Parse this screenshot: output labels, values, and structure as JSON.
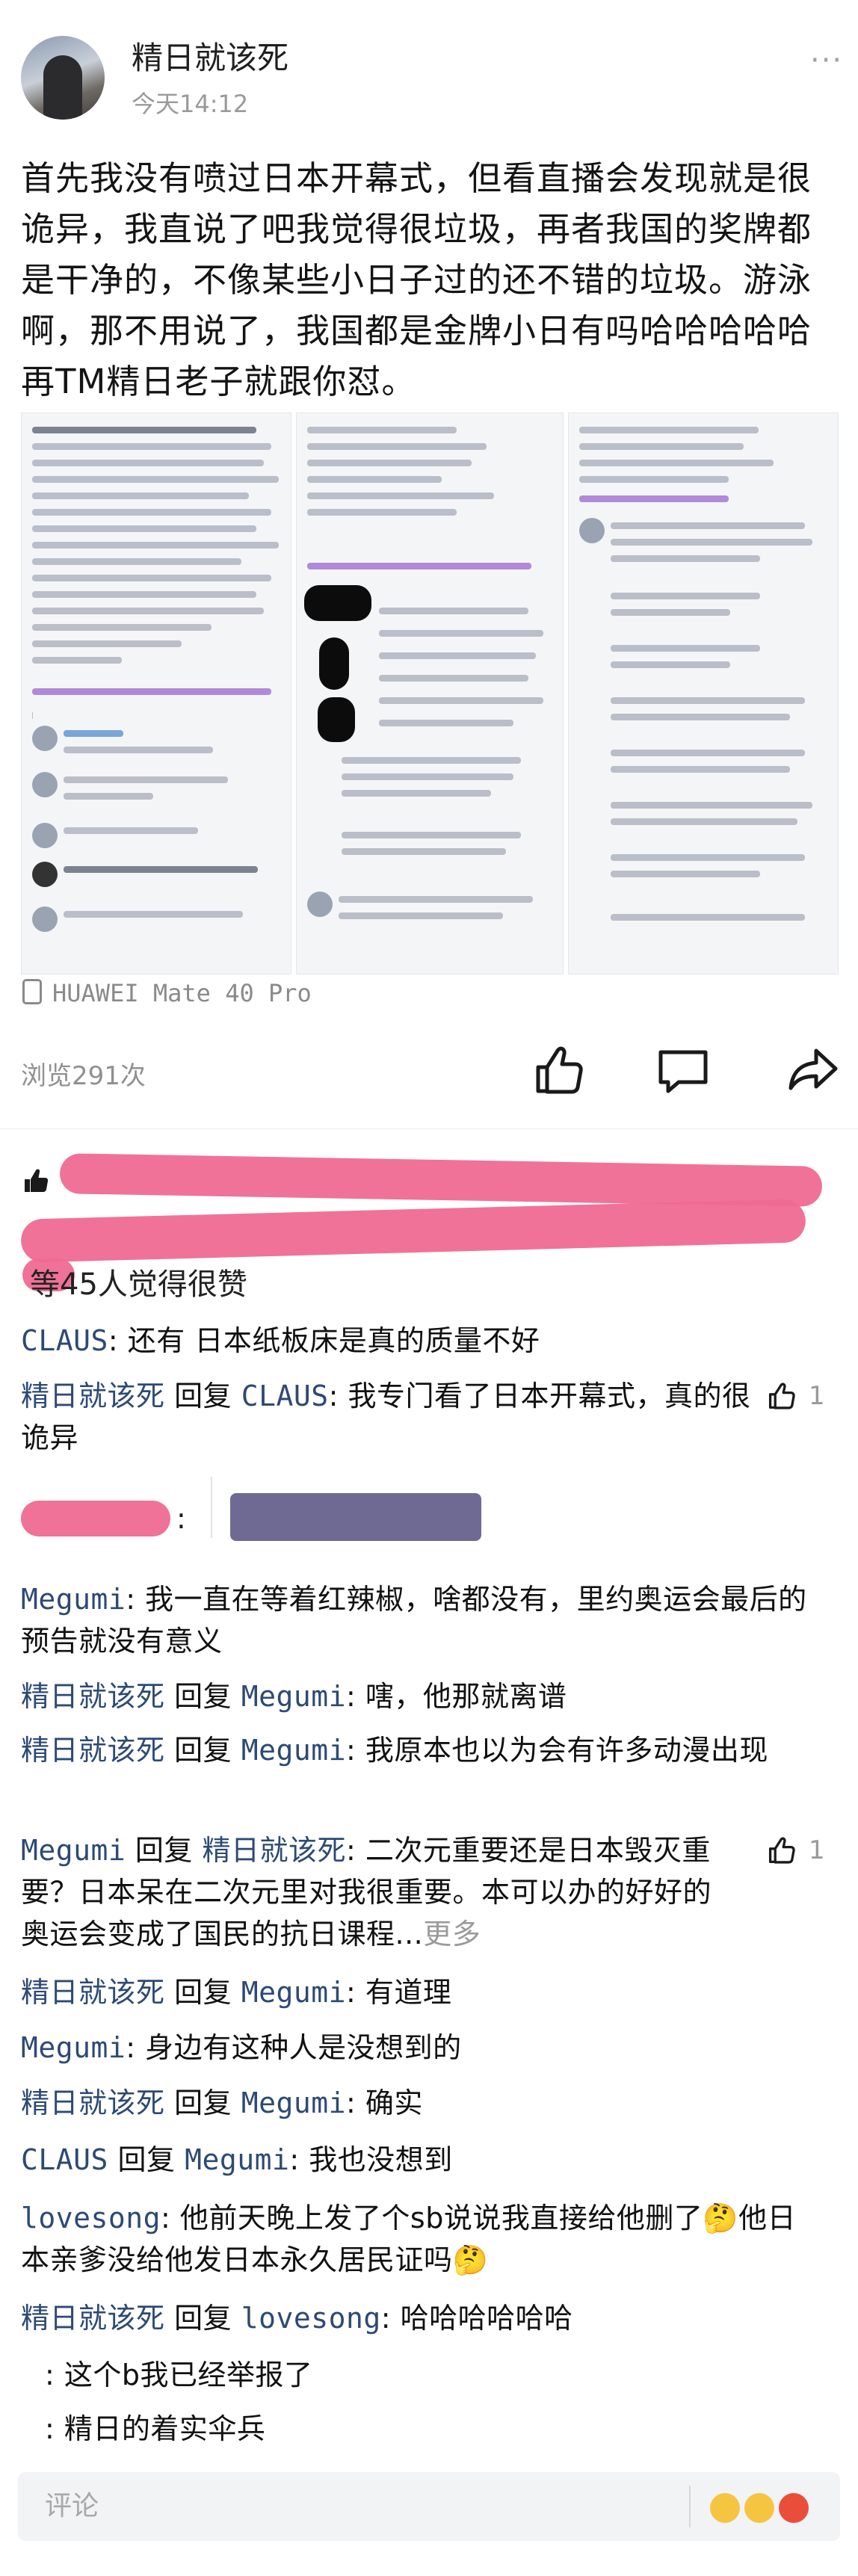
{
  "post": {
    "author": "精日就该死",
    "time": "今天14:12",
    "more": "···",
    "text": "首先我没有喷过日本开幕式，但看直播会发现就是很诡异，我直说了吧我觉得很垃圾，再者我国的奖牌都是干净的，不像某些小日子过的还不错的垃圾。游泳啊，那不用说了，我国都是金牌小日有吗哈哈哈哈哈再TM精日老子就跟你怼。",
    "device": "HUAWEI Mate 40 Pro"
  },
  "actions": {
    "views": "浏览291次",
    "icons": [
      "thumbs-up-icon",
      "comment-icon",
      "share-icon"
    ]
  },
  "likes": {
    "summary": "等45人觉得很赞"
  },
  "comments": [
    {
      "name": "CLAUS",
      "text": "还有 日本纸板床是真的质量不好"
    },
    {
      "name": "精日就该死",
      "verb": "回复",
      "target": "CLAUS",
      "text": "我专门看了日本开幕式，真的很诡异",
      "likes": "1"
    },
    {
      "name": "",
      "text": ""
    },
    {
      "name": "Megumi",
      "text": "我一直在等着红辣椒，啥都没有，里约奥运会最后的预告就没有意义"
    },
    {
      "name": "精日就该死",
      "verb": "回复",
      "target": "Megumi",
      "text": "嗐，他那就离谱"
    },
    {
      "name": "精日就该死",
      "verb": "回复",
      "target": "Megumi",
      "text": "我原本也以为会有许多动漫出现"
    },
    {
      "name": "Megumi",
      "verb": "回复",
      "target": "精日就该死",
      "text": "二次元重要还是日本毁灭重要？日本呆在二次元里对我很重要。本可以办的好好的奥运会变成了国民的抗日课程...",
      "more": "更多",
      "likes": "1"
    },
    {
      "name": "精日就该死",
      "verb": "回复",
      "target": "Megumi",
      "text": "有道理"
    },
    {
      "name": "Megumi",
      "text": "身边有这种人是没想到的"
    },
    {
      "name": "精日就该死",
      "verb": "回复",
      "target": "Megumi",
      "text": "确实"
    },
    {
      "name": "CLAUS",
      "verb": "回复",
      "target": "Megumi",
      "text": "我也没想到"
    },
    {
      "name": "lovesong",
      "text": "他前天晚上发了个sb说说我直接给他删了🤔他日本亲爹没给他发日本永久居民证吗🤔"
    },
    {
      "name": "精日就该死",
      "verb": "回复",
      "target": "lovesong",
      "text": "哈哈哈哈哈哈"
    },
    {
      "name": "",
      "text": "这个b我已经举报了"
    },
    {
      "name": "",
      "text": "精日的着实伞兵"
    }
  ],
  "input": {
    "placeholder": "评论"
  },
  "colors": {
    "name": "#2d4a73",
    "redaction": "#ef6a92",
    "background": "#ffffff"
  }
}
